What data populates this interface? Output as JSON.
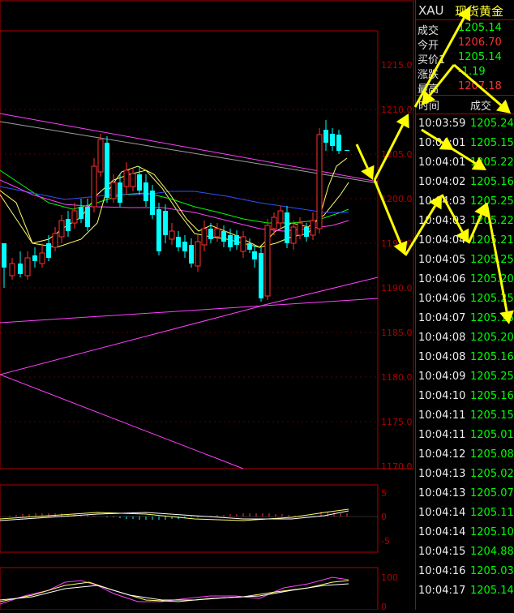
{
  "instrument": {
    "symbol": "XAU",
    "name": "现货黄金"
  },
  "quote": [
    {
      "label": "成交",
      "value": "1205.14",
      "color": "#00ff00"
    },
    {
      "label": "今开",
      "value": "1206.70",
      "color": "#ff3030"
    },
    {
      "label": "买价1",
      "value": "1205.14",
      "color": "#00ff00"
    },
    {
      "label": "涨跌",
      "value": "-1.19",
      "color": "#00ff00"
    },
    {
      "label": "最高",
      "value": "1207.18",
      "color": "#ff3030"
    }
  ],
  "ticks_header": {
    "time": "时间",
    "price": "成交"
  },
  "ticks": [
    {
      "time": "10:03:59",
      "price": "1205.24"
    },
    {
      "time": "10:04:01",
      "price": "1205.15"
    },
    {
      "time": "10:04:01",
      "price": "1205.22"
    },
    {
      "time": "10:04:02",
      "price": "1205.16"
    },
    {
      "time": "10:04:03",
      "price": "1205.25"
    },
    {
      "time": "10:04:03",
      "price": "1205.22"
    },
    {
      "time": "10:04:04",
      "price": "1205.21"
    },
    {
      "time": "10:04:05",
      "price": "1205.25"
    },
    {
      "time": "10:04:06",
      "price": "1205.20"
    },
    {
      "time": "10:04:06",
      "price": "1205.25"
    },
    {
      "time": "10:04:07",
      "price": "1205.16"
    },
    {
      "time": "10:04:08",
      "price": "1205.20"
    },
    {
      "time": "10:04:08",
      "price": "1205.16"
    },
    {
      "time": "10:04:09",
      "price": "1205.25"
    },
    {
      "time": "10:04:10",
      "price": "1205.16"
    },
    {
      "time": "10:04:11",
      "price": "1205.15"
    },
    {
      "time": "10:04:11",
      "price": "1205.01"
    },
    {
      "time": "10:04:12",
      "price": "1205.08"
    },
    {
      "time": "10:04:13",
      "price": "1205.02"
    },
    {
      "time": "10:04:13",
      "price": "1205.07"
    },
    {
      "time": "10:04:14",
      "price": "1205.11"
    },
    {
      "time": "10:04:14",
      "price": "1205.10"
    },
    {
      "time": "10:04:15",
      "price": "1204.88"
    },
    {
      "time": "10:04:16",
      "price": "1205.03"
    },
    {
      "time": "10:04:17",
      "price": "1205.14"
    }
  ],
  "price_axis": [
    "1215.0",
    "1210.0",
    "1205.0",
    "1200.0",
    "1195.0",
    "1190.0",
    "1185.0",
    "1180.0",
    "1175.0",
    "1170.0"
  ],
  "macd_axis": [
    "5",
    "0",
    "-5"
  ],
  "kdj_axis": [
    "100",
    "0"
  ],
  "colors": {
    "up": "#ff3030",
    "down": "#00ffff",
    "frame": "#b00000",
    "ma_fast": "#ffff66",
    "ma_mid": "#00ff00",
    "ma_slow": "#3050ff",
    "ma_long": "#ff40ff",
    "ma_grey": "#a0a0a0",
    "annotation": "#ffff00"
  }
}
